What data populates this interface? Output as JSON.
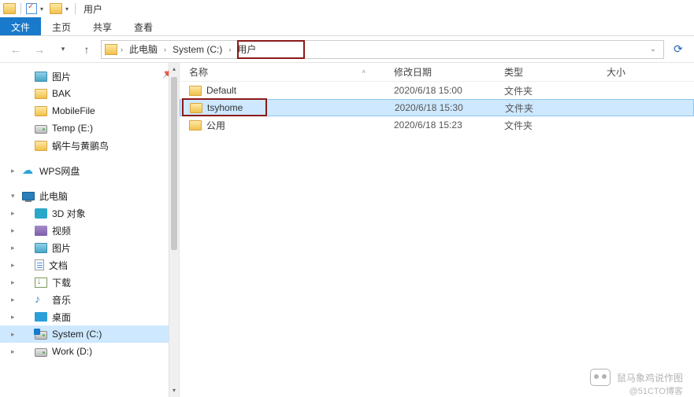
{
  "titlebar": {
    "title": "用户"
  },
  "ribbon": {
    "file": "文件",
    "tabs": [
      "主页",
      "共享",
      "查看"
    ]
  },
  "breadcrumb": {
    "segments": [
      "此电脑",
      "System (C:)",
      "用户"
    ]
  },
  "sidebar": {
    "quick": [
      {
        "label": "图片",
        "icon": "pics"
      },
      {
        "label": "BAK",
        "icon": "folder"
      },
      {
        "label": "MobileFile",
        "icon": "folder"
      },
      {
        "label": "Temp (E:)",
        "icon": "drive"
      },
      {
        "label": "蜗牛与黄鹂鸟",
        "icon": "folder"
      }
    ],
    "wps": "WPS网盘",
    "thispc": "此电脑",
    "pc_children": [
      {
        "label": "3D 对象",
        "icon": "3d"
      },
      {
        "label": "视频",
        "icon": "vid"
      },
      {
        "label": "图片",
        "icon": "pics"
      },
      {
        "label": "文档",
        "icon": "doc"
      },
      {
        "label": "下载",
        "icon": "dl"
      },
      {
        "label": "音乐",
        "icon": "music"
      },
      {
        "label": "桌面",
        "icon": "desk"
      },
      {
        "label": "System (C:)",
        "icon": "drive-sys",
        "selected": true
      },
      {
        "label": "Work (D:)",
        "icon": "drive"
      }
    ]
  },
  "columns": {
    "name": "名称",
    "date": "修改日期",
    "type": "类型",
    "size": "大小"
  },
  "files": [
    {
      "name": "Default",
      "date": "2020/6/18 15:00",
      "type": "文件夹",
      "highlight": false,
      "selected": false
    },
    {
      "name": "tsyhome",
      "date": "2020/6/18 15:30",
      "type": "文件夹",
      "highlight": true,
      "selected": true
    },
    {
      "name": "公用",
      "date": "2020/6/18 15:23",
      "type": "文件夹",
      "highlight": false,
      "selected": false
    }
  ],
  "watermark": {
    "main": "鼠马象鸡说作图",
    "sub": "@51CTO博客"
  }
}
